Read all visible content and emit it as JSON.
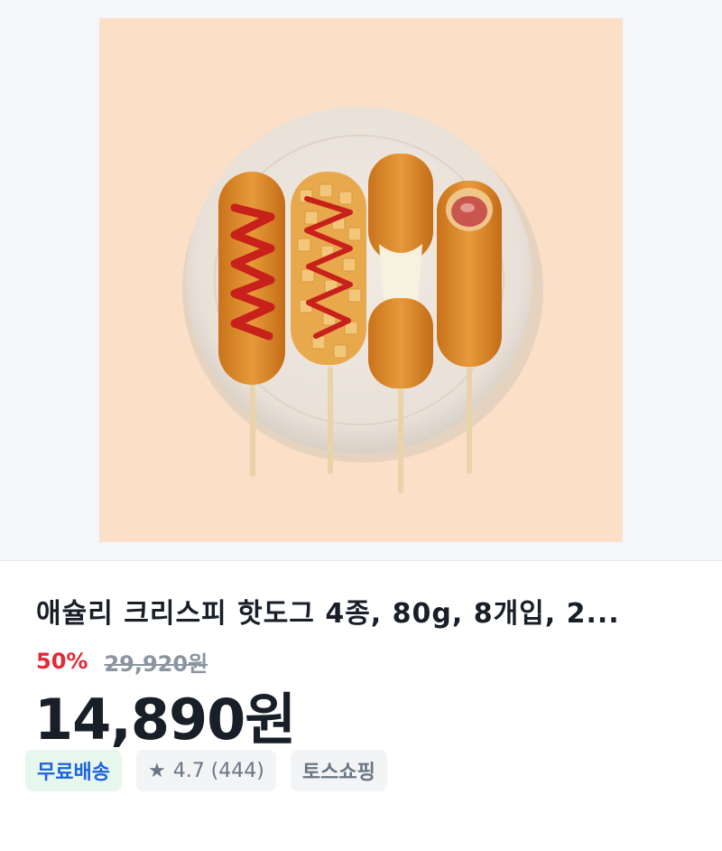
{
  "product": {
    "image_alt": "핫도그 4종 접시 사진",
    "title": "애슐리 크리스피 핫도그 4종, 80g, 8개입, 2...",
    "discount": "50%",
    "original_price": "29,920원",
    "price": "14,890원"
  },
  "badges": {
    "shipping": "무료배송",
    "rating_icon": "star-icon",
    "rating": "4.7 (444)",
    "store": "토스쇼핑"
  },
  "colors": {
    "discount": "#e42939",
    "shipping_text": "#1b64da",
    "shipping_bg": "#e8f7ee",
    "chip_bg": "#f2f4f6",
    "photo_bg": "#fbe0c7"
  }
}
